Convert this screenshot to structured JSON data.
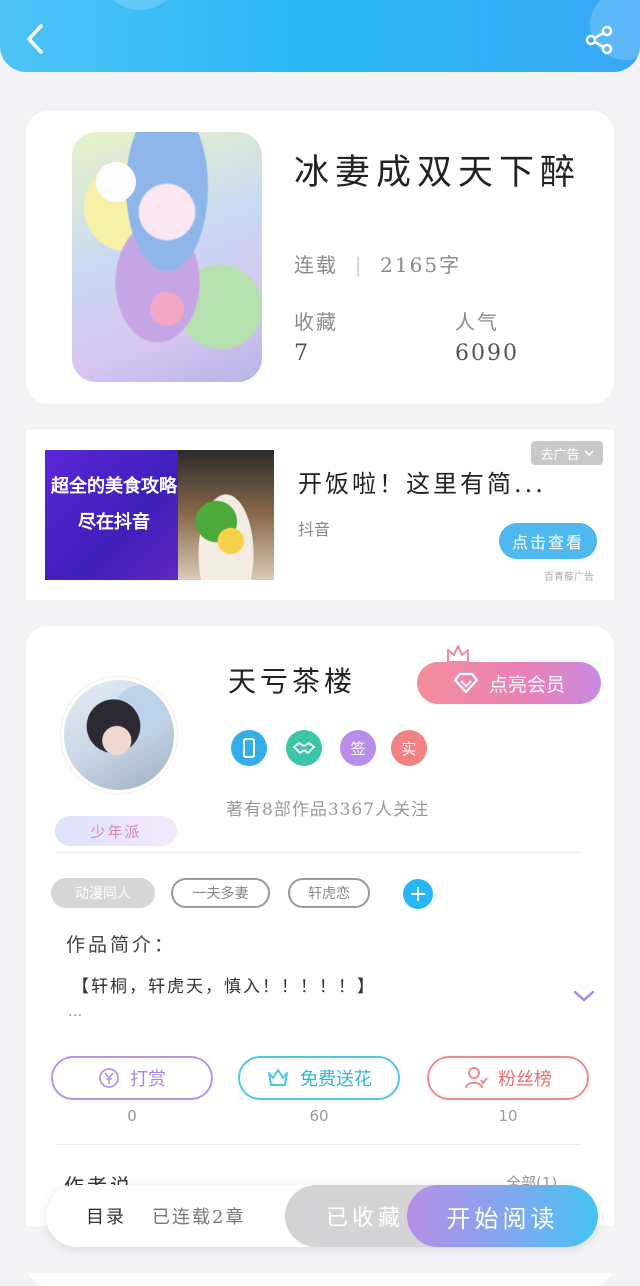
{
  "header": {
    "back_icon": "chevron-left-icon",
    "share_icon": "share-icon",
    "gradient": [
      "#4fc3f7",
      "#3aa8f5"
    ]
  },
  "book": {
    "title": "冰妻成双天下醉",
    "status": "连载",
    "word_count": "2165字",
    "favorites_label": "收藏",
    "favorites_value": "7",
    "popularity_label": "人气",
    "popularity_value": "6090"
  },
  "ad": {
    "image_line1": "超全的美食攻略",
    "image_line2": "尽在抖音",
    "title": "开饭啦！这里有简...",
    "source": "抖音",
    "close_label": "去广告",
    "cta_label": "点击查看",
    "brand": "百青藤广告"
  },
  "author": {
    "name": "天亏茶楼",
    "vip_label": "点亮会员",
    "medals": [
      "手机",
      "握手",
      "签",
      "实"
    ],
    "stats": "著有8部作品3367人关注",
    "level_tag": "少年派"
  },
  "tags": [
    "动漫同人",
    "一夫多妻",
    "轩虎恋"
  ],
  "intro": {
    "label": "作品简介：",
    "text": "【轩桐，轩虎天，慎入！！！！！】",
    "more": "..."
  },
  "actions": [
    {
      "label": "打赏",
      "count": "0",
      "icon": "yen-icon",
      "color": "#b596e6"
    },
    {
      "label": "免费送花",
      "count": "60",
      "icon": "flower-icon",
      "color": "#4fc7e6"
    },
    {
      "label": "粉丝榜",
      "count": "10",
      "icon": "fan-icon",
      "color": "#f08a8a"
    }
  ],
  "section": {
    "title": "作者说",
    "all": "全部(1)"
  },
  "bottom_bar": {
    "catalog": "目录",
    "status": "已连载2章",
    "collected": "已收藏",
    "read": "开始阅读"
  }
}
